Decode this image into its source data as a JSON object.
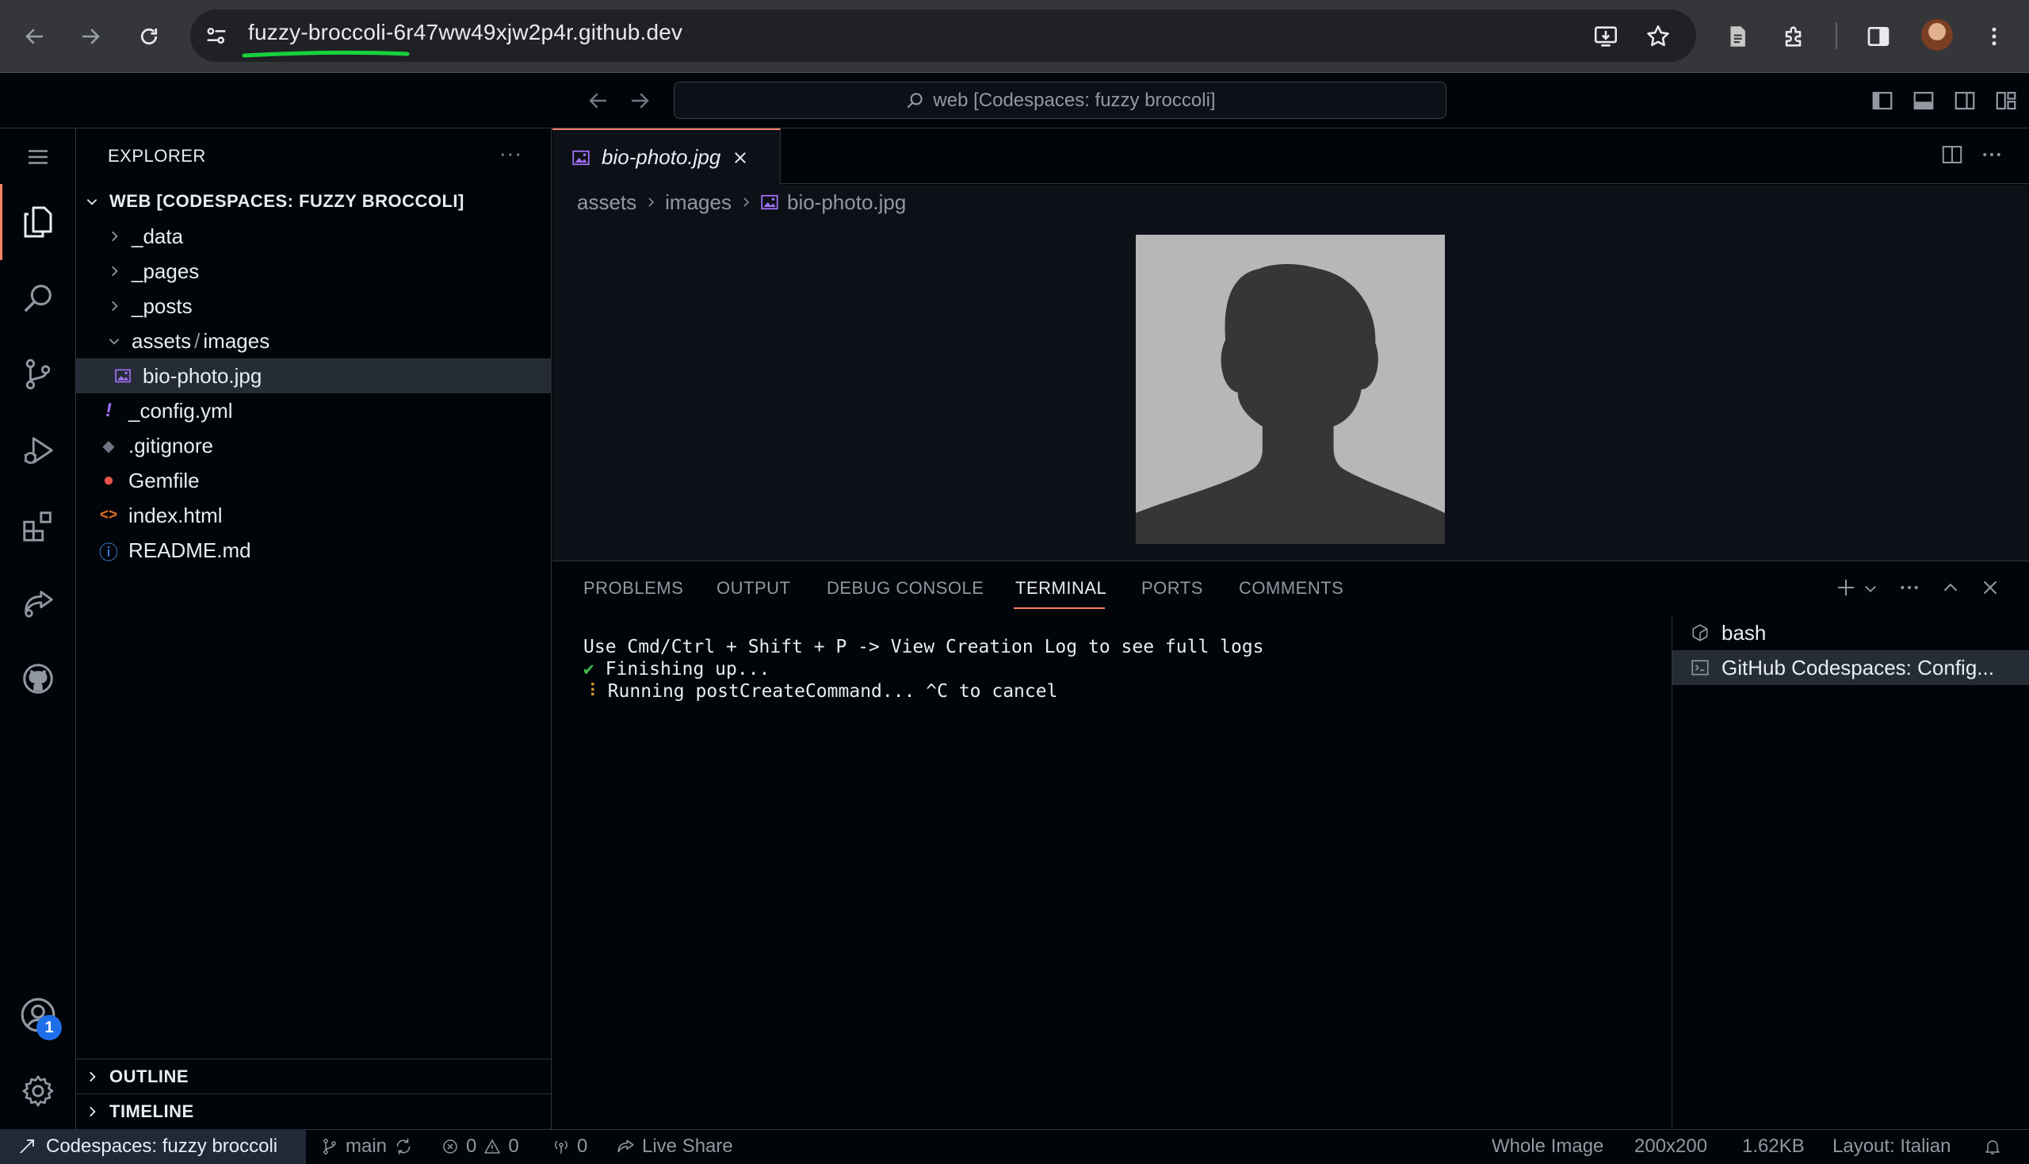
{
  "browser": {
    "url": "fuzzy-broccoli-6r47ww49xjw2p4r.github.dev",
    "icons": [
      "back-arrow-icon",
      "forward-arrow-icon",
      "reload-icon",
      "site-settings-icon",
      "install-app-icon",
      "bookmark-star-icon",
      "reading-list-icon",
      "extensions-puzzle-icon",
      "side-panel-icon",
      "profile-avatar",
      "more-vertical-icon"
    ],
    "annotation_color": "#17d23d"
  },
  "titlebar": {
    "command_center": "web [Codespaces: fuzzy broccoli]"
  },
  "activity_bar": {
    "items": [
      "menu-icon",
      "explorer-icon",
      "search-icon",
      "source-control-icon",
      "run-debug-icon",
      "extensions-icon",
      "live-share-icon",
      "github-icon"
    ],
    "accounts_badge": "1",
    "badge_color": "#1f6feb"
  },
  "explorer": {
    "title": "EXPLORER",
    "more": "···",
    "root": "WEB [CODESPACES: FUZZY BROCCOLI]",
    "items": [
      {
        "label": "_data",
        "type": "folder"
      },
      {
        "label": "_pages",
        "type": "folder"
      },
      {
        "label": "_posts",
        "type": "folder"
      },
      {
        "label": "assets",
        "sep": "/",
        "label2": "images",
        "type": "folder-open"
      },
      {
        "label": "bio-photo.jpg",
        "type": "image"
      },
      {
        "label": "_config.yml",
        "type": "yaml",
        "glyph": "!"
      },
      {
        "label": ".gitignore",
        "type": "git",
        "glyph": "◆"
      },
      {
        "label": "Gemfile",
        "type": "ruby",
        "glyph": "●"
      },
      {
        "label": "index.html",
        "type": "html",
        "glyph": "<>"
      },
      {
        "label": "README.md",
        "type": "info",
        "glyph": "ⓘ"
      }
    ],
    "outline": "OUTLINE",
    "timeline": "TIMELINE"
  },
  "editor": {
    "tab_label": "bio-photo.jpg",
    "breadcrumb": [
      "assets",
      "images",
      "bio-photo.jpg"
    ],
    "image_bg": "#b7b7b7",
    "silhouette": "#363636"
  },
  "panel": {
    "tabs": [
      "PROBLEMS",
      "OUTPUT",
      "DEBUG CONSOLE",
      "TERMINAL",
      "PORTS",
      "COMMENTS"
    ],
    "active_tab": "TERMINAL",
    "terminal_lines": [
      {
        "prefix": "",
        "text": "Use Cmd/Ctrl + Shift + P -> View Creation Log to see full logs"
      },
      {
        "prefix": "✔",
        "text": " Finishing up..."
      },
      {
        "prefix": "⠸",
        "text": " Running postCreateCommand... ^C to cancel"
      }
    ],
    "terminals": [
      "bash",
      "GitHub Codespaces: Config..."
    ]
  },
  "status": {
    "remote": "Codespaces: fuzzy broccoli",
    "branch": "main",
    "errors": "0",
    "warnings": "0",
    "ports": "0",
    "live_share": "Live Share",
    "zoom": "Whole Image",
    "dimensions": "200x200",
    "size": "1.62KB",
    "layout": "Layout: Italian"
  }
}
